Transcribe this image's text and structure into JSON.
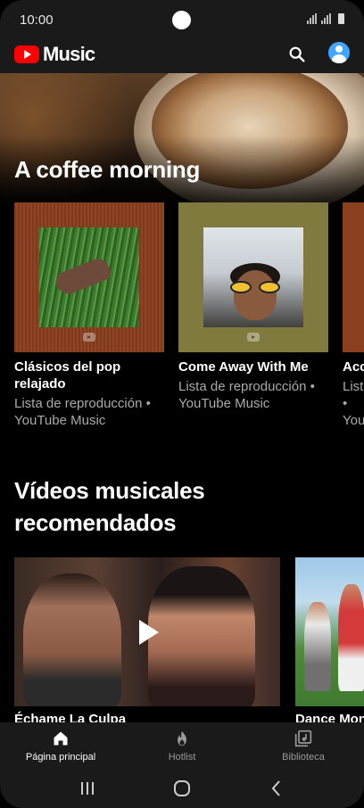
{
  "status_bar": {
    "time": "10:00"
  },
  "app": {
    "logo_text": "Music",
    "brand_color": "#ff0000",
    "icons": [
      "search-icon",
      "account-avatar"
    ]
  },
  "hero": {
    "title": "A coffee morning"
  },
  "playlists": [
    {
      "title": "Clásicos del pop relajado",
      "subtitle": "Lista de reproducción • YouTube Music"
    },
    {
      "title": "Come Away With Me",
      "subtitle": "Lista de reproducción • YouTube Music"
    },
    {
      "title": "Acc",
      "subtitle": "List • You"
    }
  ],
  "videos_section": {
    "title": "Vídeos musicales recomendados",
    "videos": [
      {
        "title": "Échame La Culpa"
      },
      {
        "title": "Dance Monk"
      }
    ]
  },
  "bottom_nav": {
    "items": [
      {
        "label": "Página principal",
        "icon": "home-icon",
        "active": true
      },
      {
        "label": "Hotlist",
        "icon": "flame-icon",
        "active": false
      },
      {
        "label": "Biblioteca",
        "icon": "library-icon",
        "active": false
      }
    ]
  },
  "system_nav": {
    "icons": [
      "recent-apps-icon",
      "home-button-icon",
      "back-icon"
    ]
  }
}
